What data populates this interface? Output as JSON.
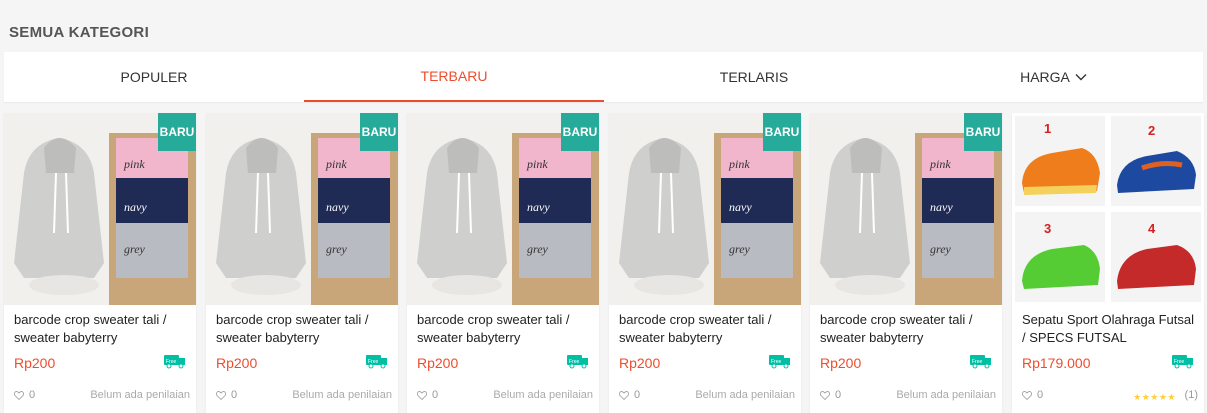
{
  "heading": "SEMUA KATEGORI",
  "tabs": [
    {
      "label": "POPULER"
    },
    {
      "label": "TERBARU"
    },
    {
      "label": "TERLARIS"
    },
    {
      "label": "HARGA"
    }
  ],
  "colors": {
    "accent": "#ee4d2d",
    "badge": "#26aa99",
    "star": "#ffce3d"
  },
  "products": [
    {
      "title": "barcode crop sweater tali / sweater babyterry",
      "price": "Rp200",
      "badge": "BARU",
      "likes": "0",
      "rating_text": "Belum ada penilaian",
      "free_label": "Free"
    },
    {
      "title": "barcode crop sweater tali / sweater babyterry",
      "price": "Rp200",
      "badge": "BARU",
      "likes": "0",
      "rating_text": "Belum ada penilaian",
      "free_label": "Free"
    },
    {
      "title": "barcode crop sweater tali / sweater babyterry",
      "price": "Rp200",
      "badge": "BARU",
      "likes": "0",
      "rating_text": "Belum ada penilaian",
      "free_label": "Free"
    },
    {
      "title": "barcode crop sweater tali / sweater babyterry",
      "price": "Rp200",
      "badge": "BARU",
      "likes": "0",
      "rating_text": "Belum ada penilaian",
      "free_label": "Free"
    },
    {
      "title": "barcode crop sweater tali / sweater babyterry",
      "price": "Rp200",
      "badge": "BARU",
      "likes": "0",
      "rating_text": "Belum ada penilaian",
      "free_label": "Free"
    },
    {
      "title": "Sepatu Sport Olahraga Futsal / SPECS FUTSAL",
      "price": "Rp179.000",
      "likes": "0",
      "stars": 5,
      "rating_count": "(1)",
      "free_label": "Free"
    }
  ],
  "sweater_labels": {
    "pink": "pink",
    "navy": "navy",
    "grey": "grey"
  },
  "shoe_numbers": [
    "1",
    "2",
    "3",
    "4"
  ]
}
